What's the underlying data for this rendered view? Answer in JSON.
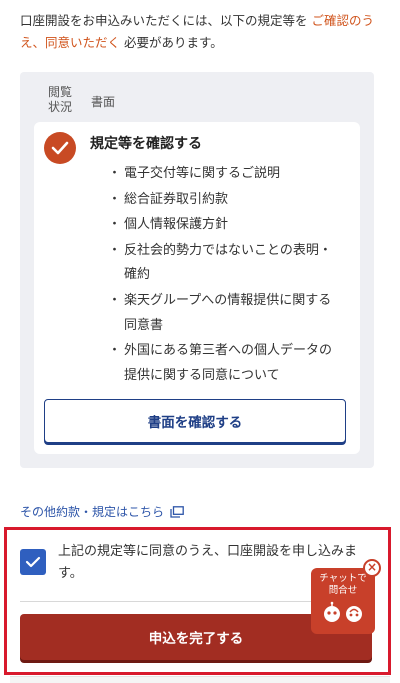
{
  "intro": {
    "text_before": "口座開設をお申込みいただくには、以下の規定等を",
    "link_text": "ご確認のうえ、同意いただく",
    "text_after": "必要があります。"
  },
  "panel": {
    "col_status": "閲覧状況",
    "col_doc": "書面",
    "card": {
      "title": "規定等を確認する",
      "documents": [
        "電子交付等に関するご説明",
        "総合証券取引約款",
        "個人情報保護方針",
        "反社会的勢力ではないことの表明・確約",
        "楽天グループへの情報提供に関する同意書",
        "外国にある第三者への個人データの提供に関する同意について"
      ],
      "confirm_button": "書面を確認する"
    }
  },
  "other_link": "その他約款・規定はこちら",
  "agree": {
    "label": "上記の規定等に同意のうえ、口座開設を申し込みます。",
    "checked": true
  },
  "submit_button": "申込を完了する",
  "chat": {
    "label_line1": "チャットで",
    "label_line2": "問合せ",
    "close": "×"
  },
  "colors": {
    "accent_red": "#a22d22",
    "link_orange": "#d0531b",
    "link_blue": "#2c54a8",
    "checkbox_blue": "#2f5fbf",
    "highlight_frame": "#d8192c"
  }
}
